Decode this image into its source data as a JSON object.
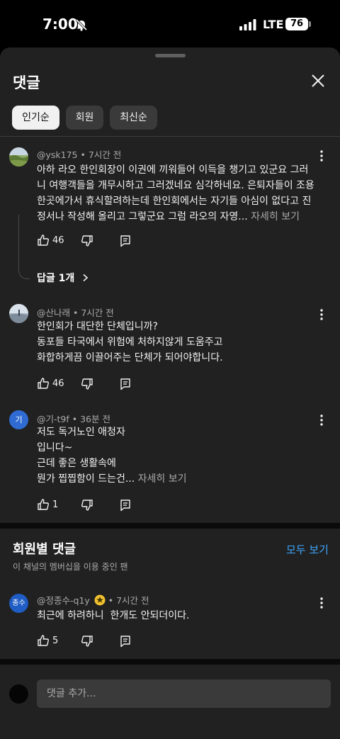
{
  "status_bar": {
    "time": "7:00",
    "network": "LTE",
    "battery": "76"
  },
  "sheet": {
    "title": "댓글",
    "filters": [
      "인기순",
      "회원",
      "최신순"
    ]
  },
  "comments": [
    {
      "author": "@ysk175",
      "time": "7시간 전",
      "text": "아하 라오 한인회장이 이권에 끼워들어 이득을 챙기고 있군요 그러니 여행객들을 개무시하고 그러겠네요 심각하네요. 은퇴자들이 조용한곳에가서 휴식할려하는데 한인회에서는 자기들 아심이 없다고 진정서나 작성해 올리고 그렇군요 그럼 라오의 자영...",
      "more": "자세히 보기",
      "likes": "46",
      "replies": "답글 1개"
    },
    {
      "author": "@산나래",
      "time": "7시간 전",
      "text": "한인회가 대단한 단체입니까?\n동포들 타국에서 위험에 처하지않게 도움주고\n화합하게끔 이끌어주는 단체가 되어야합니다.",
      "likes": "46"
    },
    {
      "author": "@기-t9f",
      "avatar_letter": "기",
      "time": "36분 전",
      "text": "저도 독거노인 애청자\n입니다~\n근데 좋은 생활속에\n뭔가 찝찝함이 드는건...",
      "more": "자세히 보기",
      "likes": "1"
    }
  ],
  "members_section": {
    "title": "회원별 댓글",
    "subtitle": "이 채널의 멤버십을 이용 중인 팬",
    "see_all": "모두 보기",
    "comment": {
      "author": "@정종수-q1y",
      "avatar_letter": "종수",
      "time": "7시간 전",
      "text": "최근에 하려하니  한개도 안되더이다.",
      "likes": "5"
    }
  },
  "composer": {
    "placeholder": "댓글 추가..."
  },
  "colors": {
    "accent": "#3ea6ff",
    "sheet_bg": "#212121",
    "chip_active": "#f1f1f1",
    "badge": "#f2c230"
  }
}
